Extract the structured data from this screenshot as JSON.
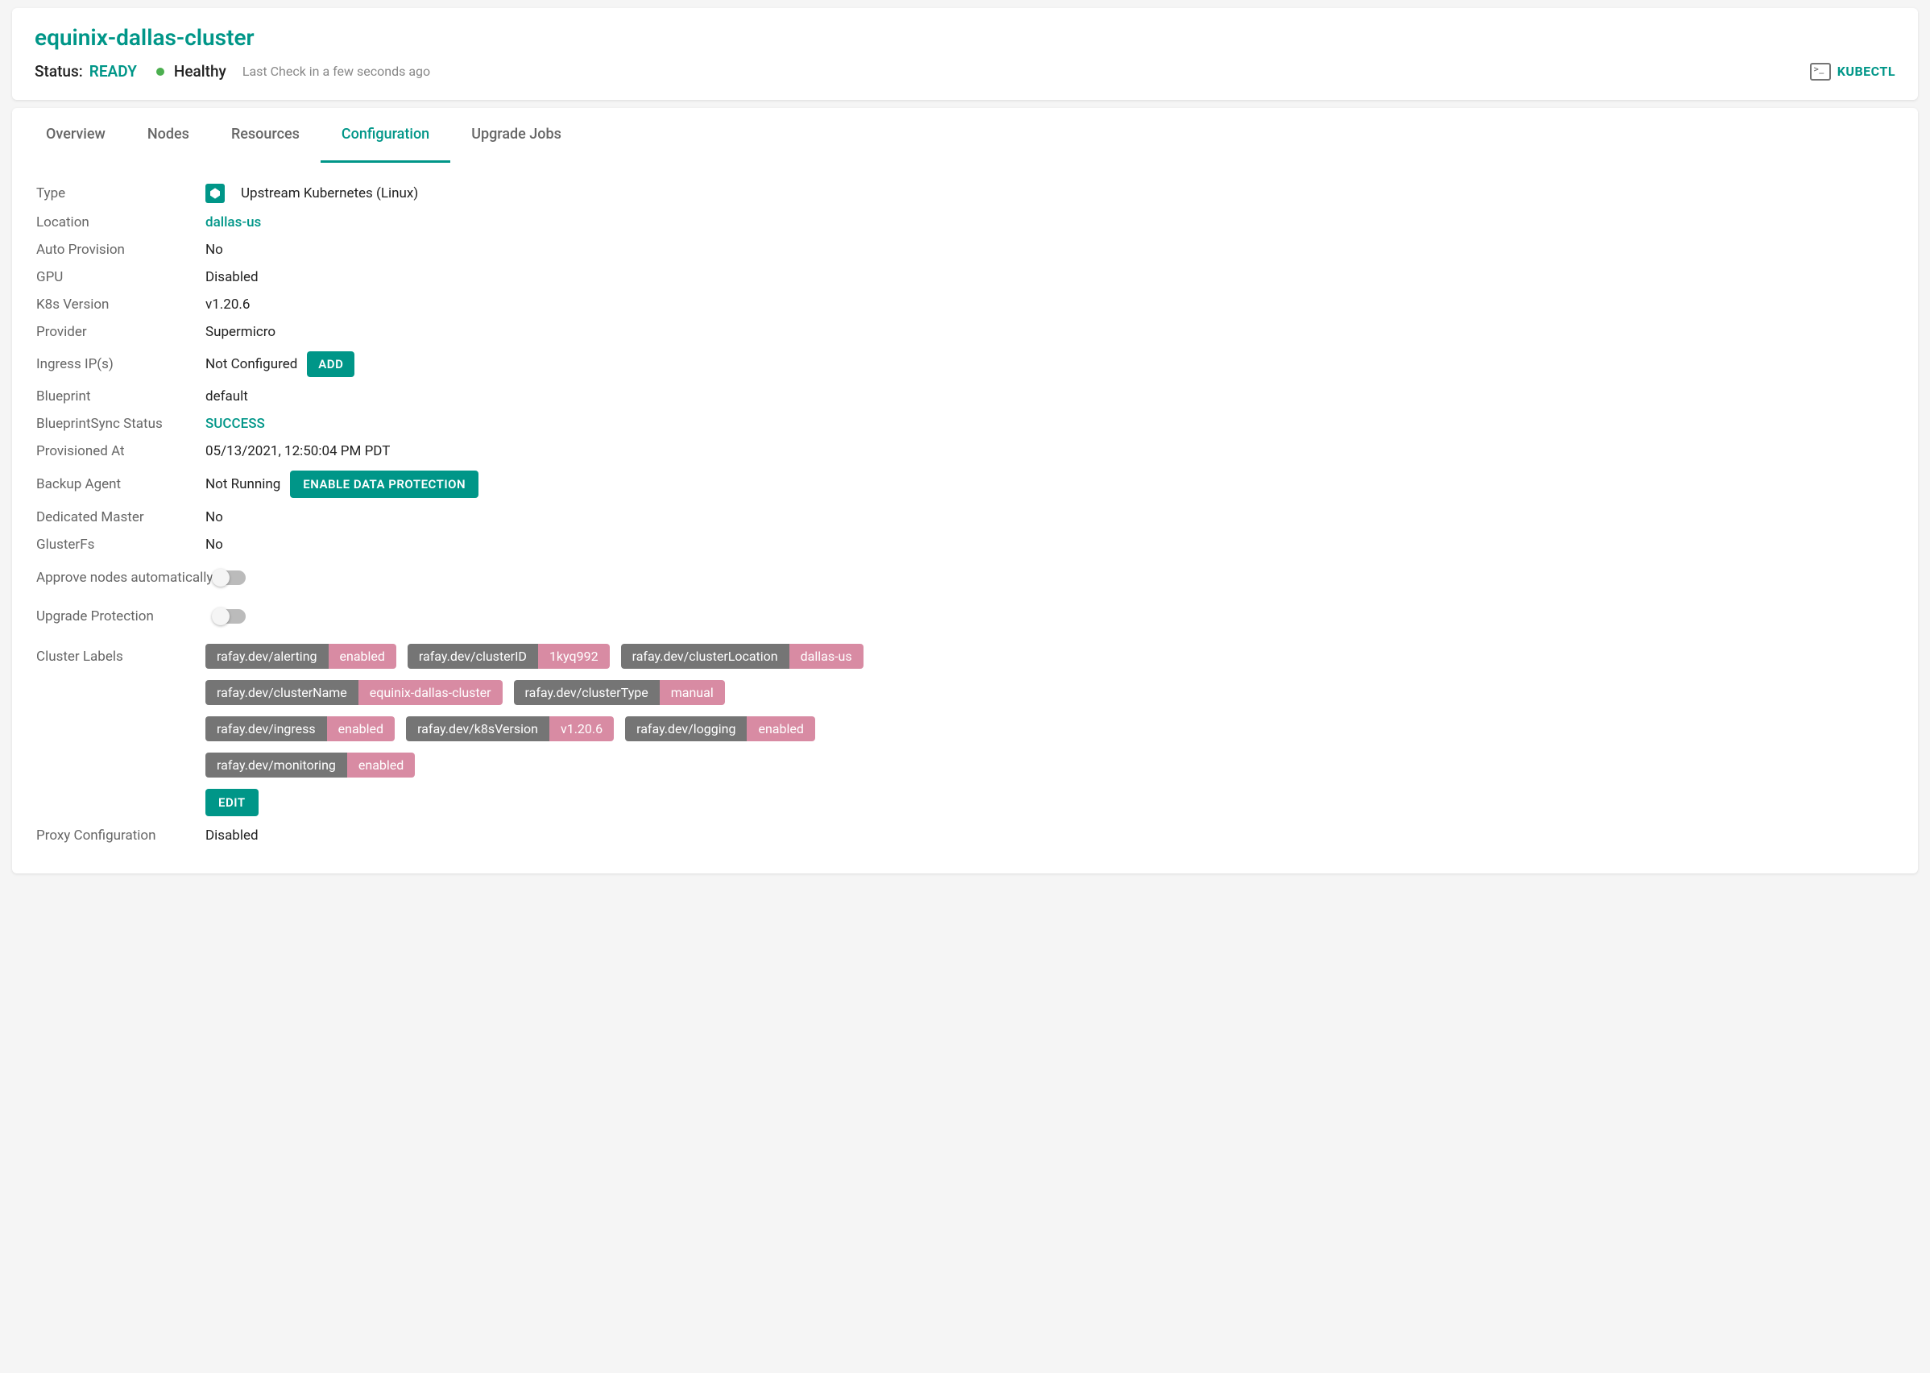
{
  "header": {
    "cluster_name": "equinix-dallas-cluster",
    "status_label": "Status:",
    "status_value": "READY",
    "health_text": "Healthy",
    "last_check": "Last Check in a few seconds ago",
    "kubectl_label": "KUBECTL"
  },
  "tabs": {
    "overview": "Overview",
    "nodes": "Nodes",
    "resources": "Resources",
    "configuration": "Configuration",
    "upgrade_jobs": "Upgrade Jobs"
  },
  "config": {
    "type_label": "Type",
    "type_value": "Upstream Kubernetes (Linux)",
    "location_label": "Location",
    "location_value": "dallas-us",
    "auto_provision_label": "Auto Provision",
    "auto_provision_value": "No",
    "gpu_label": "GPU",
    "gpu_value": "Disabled",
    "k8s_version_label": "K8s Version",
    "k8s_version_value": "v1.20.6",
    "provider_label": "Provider",
    "provider_value": "Supermicro",
    "ingress_label": "Ingress IP(s)",
    "ingress_value": "Not Configured",
    "ingress_add_btn": "ADD",
    "blueprint_label": "Blueprint",
    "blueprint_value": "default",
    "blueprint_sync_label": "BlueprintSync Status",
    "blueprint_sync_value": "SUCCESS",
    "provisioned_label": "Provisioned At",
    "provisioned_value": "05/13/2021, 12:50:04 PM PDT",
    "backup_label": "Backup Agent",
    "backup_value": "Not Running",
    "backup_btn": "ENABLE DATA PROTECTION",
    "dedicated_master_label": "Dedicated Master",
    "dedicated_master_value": "No",
    "glusterfs_label": "GlusterFs",
    "glusterfs_value": "No",
    "approve_nodes_label": "Approve nodes automatically",
    "upgrade_protection_label": "Upgrade Protection",
    "cluster_labels_label": "Cluster Labels",
    "edit_btn": "EDIT",
    "proxy_label": "Proxy Configuration",
    "proxy_value": "Disabled"
  },
  "cluster_labels": [
    {
      "key": "rafay.dev/alerting",
      "value": "enabled"
    },
    {
      "key": "rafay.dev/clusterID",
      "value": "1kyq992"
    },
    {
      "key": "rafay.dev/clusterLocation",
      "value": "dallas-us"
    },
    {
      "key": "rafay.dev/clusterName",
      "value": "equinix-dallas-cluster"
    },
    {
      "key": "rafay.dev/clusterType",
      "value": "manual"
    },
    {
      "key": "rafay.dev/ingress",
      "value": "enabled"
    },
    {
      "key": "rafay.dev/k8sVersion",
      "value": "v1.20.6"
    },
    {
      "key": "rafay.dev/logging",
      "value": "enabled"
    },
    {
      "key": "rafay.dev/monitoring",
      "value": "enabled"
    }
  ]
}
